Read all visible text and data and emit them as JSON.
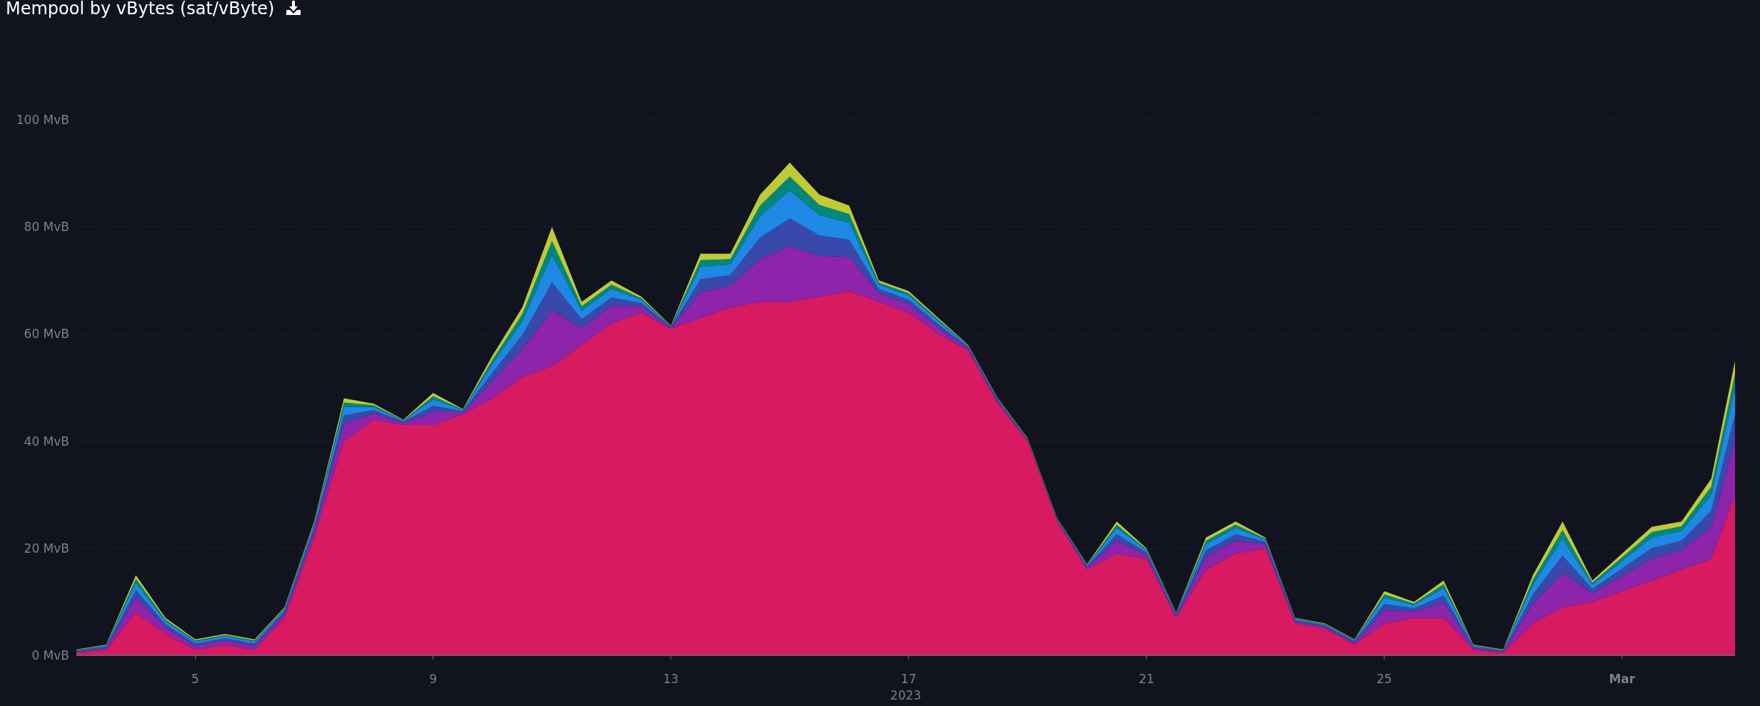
{
  "title": "Mempool by vBytes (sat/vByte)",
  "chart": {
    "chart_data": {
      "type": "area",
      "stacked": true,
      "grid": true,
      "x": [
        3,
        3.5,
        4,
        4.5,
        5,
        5.5,
        6,
        6.5,
        7,
        7.5,
        8,
        8.5,
        9,
        9.5,
        10,
        10.5,
        11,
        11.5,
        12,
        12.5,
        13,
        13.5,
        14,
        14.5,
        15,
        15.5,
        16,
        16.5,
        17,
        17.5,
        18,
        18.5,
        19,
        19.5,
        20,
        20.5,
        21,
        21.5,
        22,
        22.5,
        23,
        23.5,
        24,
        24.5,
        25,
        25.5,
        26,
        26.5,
        27,
        27.5,
        28,
        28.5,
        29,
        29.5,
        30,
        30.5,
        30.9
      ],
      "xlim": [
        3,
        30.9
      ],
      "ylim": [
        0,
        100
      ],
      "xticks": [
        {
          "value": 5,
          "label": "5"
        },
        {
          "value": 9,
          "label": "9"
        },
        {
          "value": 13,
          "label": "13"
        },
        {
          "value": 17,
          "label": "17"
        },
        {
          "value": 21,
          "label": "21"
        },
        {
          "value": 25,
          "label": "25"
        },
        {
          "value": 29,
          "label": "Mar"
        }
      ],
      "yticks": [
        {
          "value": 0,
          "label": "0 MvB"
        },
        {
          "value": 20,
          "label": "20 MvB"
        },
        {
          "value": 40,
          "label": "40 MvB"
        },
        {
          "value": 60,
          "label": "60 MvB"
        },
        {
          "value": 80,
          "label": "80 MvB"
        },
        {
          "value": 100,
          "label": "100 MvB"
        }
      ],
      "annotations": [
        "2023"
      ],
      "series": [
        {
          "color": "#d81b60",
          "values": [
            0.5,
            1,
            8,
            4,
            1,
            2,
            1,
            7,
            22,
            40,
            44,
            43,
            43,
            45,
            48,
            52,
            54,
            58,
            62,
            64,
            61,
            63,
            65,
            66,
            66,
            67,
            68,
            66,
            64,
            60,
            57,
            47,
            40,
            25,
            16,
            19,
            18,
            7,
            16,
            19,
            20,
            6,
            5,
            2,
            6,
            7,
            7,
            1,
            0.5,
            6,
            9,
            10,
            12,
            14,
            16,
            18,
            30
          ]
        },
        {
          "color": "#8e24aa",
          "values": [
            0.2,
            0.4,
            2.8,
            1.2,
            0.8,
            0.8,
            0.8,
            0.8,
            1.2,
            3.2,
            1.2,
            0.4,
            2.4,
            0.4,
            3.2,
            5.2,
            10.4,
            3.2,
            3.2,
            1.2,
            0.2,
            4.8,
            4,
            8,
            10.4,
            7.6,
            6.4,
            1.6,
            1.6,
            1.2,
            0.4,
            0.4,
            0.2,
            0.2,
            0.4,
            2.4,
            0.8,
            0.4,
            2.4,
            2.4,
            0.8,
            0.4,
            0.4,
            0.4,
            2.4,
            1.2,
            2.8,
            0.4,
            0.2,
            3.6,
            6.4,
            1.6,
            2.8,
            4,
            3.6,
            6,
            10
          ]
        },
        {
          "color": "#3949ab",
          "values": [
            0.1,
            0.2,
            1.4,
            0.6,
            0.4,
            0.4,
            0.4,
            0.4,
            0.6,
            1.6,
            0.6,
            0.2,
            1.2,
            0.2,
            1.6,
            2.6,
            5.2,
            1.6,
            1.6,
            0.6,
            0.1,
            2.4,
            2,
            4,
            5.2,
            3.8,
            3.2,
            0.8,
            0.8,
            0.6,
            0.2,
            0.2,
            0.1,
            0.1,
            0.2,
            1.2,
            0.4,
            0.2,
            1.2,
            1.2,
            0.4,
            0.2,
            0.2,
            0.2,
            1.2,
            0.6,
            1.4,
            0.2,
            0.1,
            1.8,
            3.2,
            0.8,
            1.4,
            2,
            1.8,
            3,
            5
          ]
        },
        {
          "color": "#1e88e5",
          "values": [
            0.1,
            0.2,
            1.4,
            0.6,
            0.4,
            0.4,
            0.4,
            0.4,
            0.6,
            1.6,
            0.6,
            0.2,
            1.2,
            0.2,
            1.6,
            2.6,
            5.2,
            1.6,
            1.6,
            0.6,
            0.1,
            2.4,
            2,
            4,
            5.2,
            3.8,
            3.2,
            0.8,
            0.8,
            0.6,
            0.2,
            0.2,
            0.1,
            0.1,
            0.2,
            1.2,
            0.4,
            0.2,
            1.2,
            1.2,
            0.4,
            0.2,
            0.2,
            0.2,
            1.2,
            0.6,
            1.4,
            0.2,
            0.1,
            1.8,
            3.2,
            0.8,
            1.4,
            2,
            1.8,
            3,
            5
          ]
        },
        {
          "color": "#00897b",
          "values": [
            0.1,
            0.1,
            0.7,
            0.3,
            0.2,
            0.2,
            0.2,
            0.2,
            0.3,
            0.8,
            0.3,
            0.1,
            0.6,
            0.1,
            0.8,
            1.3,
            2.6,
            0.8,
            0.8,
            0.3,
            0.1,
            1.2,
            1,
            2,
            2.6,
            1.9,
            1.6,
            0.4,
            0.4,
            0.3,
            0.1,
            0.1,
            0.1,
            0.1,
            0.1,
            0.6,
            0.2,
            0.1,
            0.6,
            0.6,
            0.2,
            0.1,
            0.1,
            0.1,
            0.6,
            0.3,
            0.7,
            0.1,
            0.1,
            0.9,
            1.6,
            0.4,
            0.7,
            1,
            0.9,
            1.5,
            2.5
          ]
        },
        {
          "color": "#c0ca33",
          "values": [
            0.1,
            0.1,
            0.7,
            0.3,
            0.2,
            0.2,
            0.2,
            0.2,
            0.3,
            0.8,
            0.3,
            0.1,
            0.6,
            0.1,
            0.8,
            1.3,
            2.6,
            0.8,
            0.8,
            0.3,
            0.1,
            1.2,
            1,
            2,
            2.6,
            1.9,
            1.6,
            0.4,
            0.4,
            0.3,
            0.1,
            0.1,
            0.1,
            0.1,
            0.1,
            0.6,
            0.2,
            0.1,
            0.6,
            0.6,
            0.2,
            0.1,
            0.1,
            0.1,
            0.6,
            0.3,
            0.7,
            0.1,
            0.1,
            0.9,
            1.6,
            0.4,
            0.7,
            1,
            0.9,
            1.5,
            2.5
          ]
        }
      ]
    }
  }
}
